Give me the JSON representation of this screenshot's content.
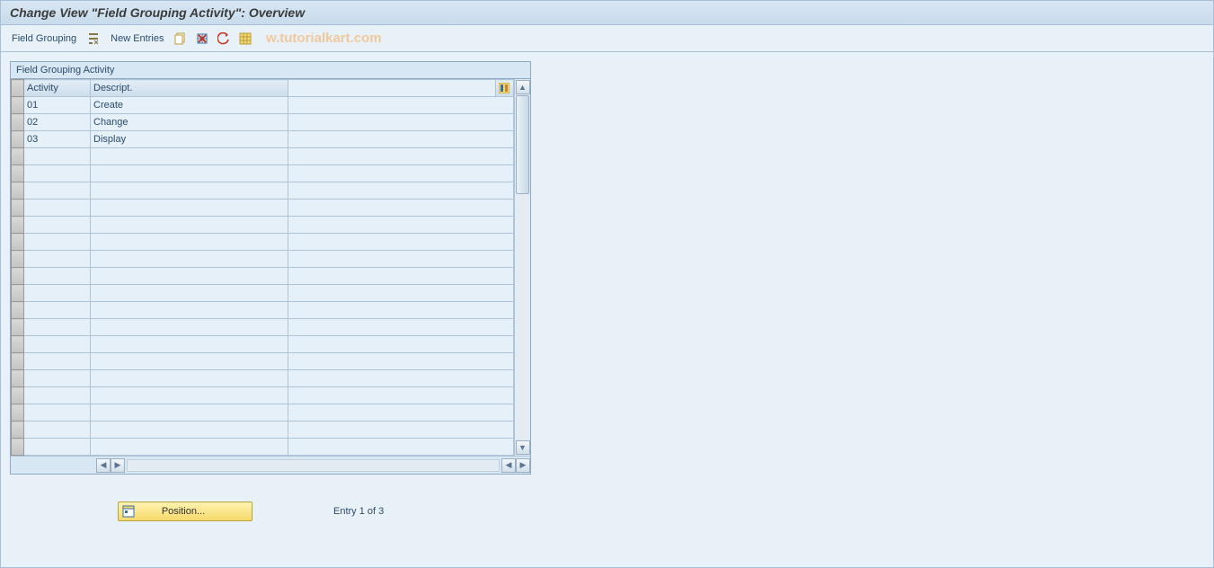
{
  "title": "Change View \"Field Grouping Activity\": Overview",
  "toolbar": {
    "field_grouping_label": "Field Grouping",
    "new_entries_label": "New Entries",
    "icons": {
      "details": "details-icon",
      "copy": "copy-icon",
      "delete": "delete-icon",
      "undo": "undo-icon",
      "select_all": "select-all-icon"
    }
  },
  "watermark": "w.tutorialkart.com",
  "table": {
    "group_title": "Field Grouping Activity",
    "columns": {
      "activity": "Activity",
      "descript": "Descript."
    },
    "rows": [
      {
        "activity": "01",
        "descript": "Create"
      },
      {
        "activity": "02",
        "descript": "Change"
      },
      {
        "activity": "03",
        "descript": "Display"
      }
    ],
    "empty_row_count": 18
  },
  "footer": {
    "position_label": "Position...",
    "entry_text": "Entry 1 of 3"
  }
}
